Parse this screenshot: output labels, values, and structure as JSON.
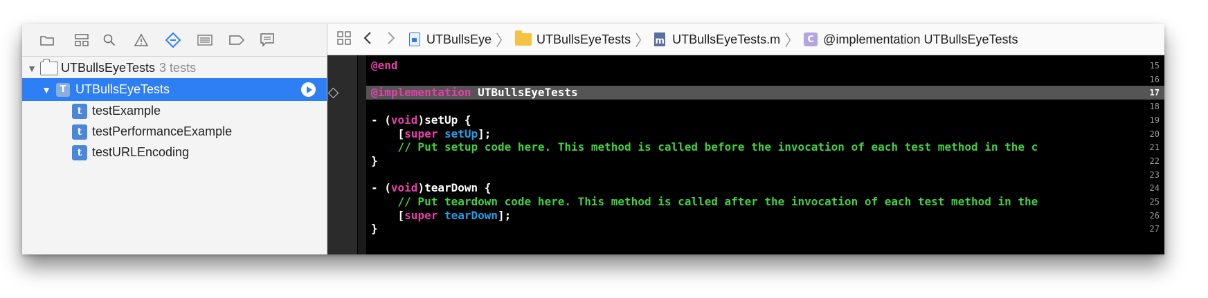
{
  "navigator": {
    "toolbar_icons": [
      "folder-icon",
      "hierarchy-icon",
      "search-icon",
      "warning-icon",
      "test-diamond-icon",
      "list-icon",
      "breakpoint-icon",
      "report-icon"
    ],
    "project": {
      "name": "UTBullsEyeTests",
      "count": "3 tests"
    },
    "target": {
      "name": "UTBullsEyeTests"
    },
    "tests": [
      {
        "icon": "t",
        "name": "testExample"
      },
      {
        "icon": "t",
        "name": "testPerformanceExample"
      },
      {
        "icon": "t",
        "name": "testURLEncoding"
      }
    ]
  },
  "jumpbar": {
    "project": "UTBullsEye",
    "group": "UTBullsEyeTests",
    "file_icon": "m",
    "file": "UTBullsEyeTests.m",
    "class_icon": "C",
    "symbol": "@implementation UTBullsEyeTests"
  },
  "editor": {
    "current_line": "17",
    "lines": [
      {
        "num": "15",
        "parts": [
          {
            "t": "@end",
            "c": "kw"
          }
        ]
      },
      {
        "num": "16",
        "parts": []
      },
      {
        "num": "17",
        "parts": [
          {
            "t": "@implementation",
            "c": "kw"
          },
          {
            "t": " UTBullsEyeTests",
            "c": ""
          }
        ]
      },
      {
        "num": "18",
        "parts": []
      },
      {
        "num": "19",
        "parts": [
          {
            "t": "- (",
            "c": ""
          },
          {
            "t": "void",
            "c": "kw"
          },
          {
            "t": ")setUp {",
            "c": ""
          }
        ]
      },
      {
        "num": "20",
        "parts": [
          {
            "t": "    [",
            "c": ""
          },
          {
            "t": "super",
            "c": "kw"
          },
          {
            "t": " ",
            "c": ""
          },
          {
            "t": "setUp",
            "c": "fn"
          },
          {
            "t": "];",
            "c": ""
          }
        ]
      },
      {
        "num": "21",
        "parts": [
          {
            "t": "    // Put setup code here. This method is called before the invocation of each test method in the c",
            "c": "cm"
          }
        ]
      },
      {
        "num": "22",
        "parts": [
          {
            "t": "}",
            "c": ""
          }
        ]
      },
      {
        "num": "23",
        "parts": []
      },
      {
        "num": "24",
        "parts": [
          {
            "t": "- (",
            "c": ""
          },
          {
            "t": "void",
            "c": "kw"
          },
          {
            "t": ")tearDown {",
            "c": ""
          }
        ]
      },
      {
        "num": "25",
        "parts": [
          {
            "t": "    // Put teardown code here. This method is called after the invocation of each test method in the",
            "c": "cm"
          }
        ]
      },
      {
        "num": "26",
        "parts": [
          {
            "t": "    [",
            "c": ""
          },
          {
            "t": "super",
            "c": "kw"
          },
          {
            "t": " ",
            "c": ""
          },
          {
            "t": "tearDown",
            "c": "fn"
          },
          {
            "t": "];",
            "c": ""
          }
        ]
      },
      {
        "num": "27",
        "parts": [
          {
            "t": "}",
            "c": ""
          }
        ]
      }
    ]
  }
}
